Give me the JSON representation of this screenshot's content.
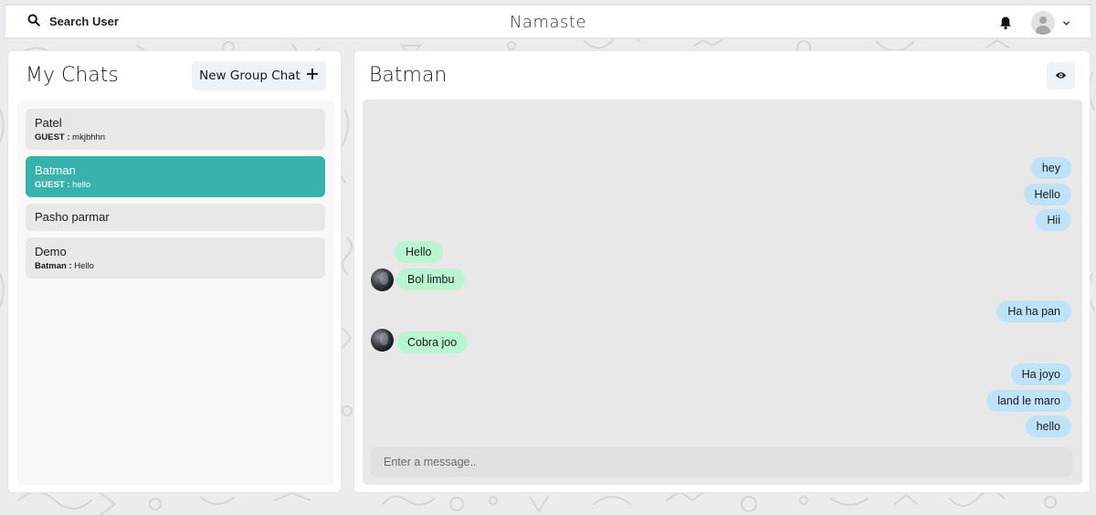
{
  "header": {
    "search_label": "Search User",
    "brand": "Namaste"
  },
  "chats_panel": {
    "title": "My Chats",
    "new_group_label": "New Group Chat",
    "chats": [
      {
        "name": "Patel",
        "sender": "GUEST :",
        "preview": "mkjbhhn",
        "active": false
      },
      {
        "name": "Batman",
        "sender": "GUEST :",
        "preview": "hello",
        "active": true
      },
      {
        "name": "Pasho parmar",
        "sender": "",
        "preview": "",
        "active": false
      },
      {
        "name": "Demo",
        "sender": "Batman :",
        "preview": "Hello",
        "active": false
      }
    ]
  },
  "conversation": {
    "title": "Batman",
    "messages": [
      {
        "text": "hey",
        "direction": "sent"
      },
      {
        "text": "Hello",
        "direction": "sent"
      },
      {
        "text": "Hii",
        "direction": "sent"
      },
      {
        "text": "Hello",
        "direction": "received"
      },
      {
        "text": "Bol limbu",
        "direction": "received"
      },
      {
        "text": "Ha ha pan",
        "direction": "sent"
      },
      {
        "text": "Cobra joo",
        "direction": "received"
      },
      {
        "text": "Ha joyo",
        "direction": "sent"
      },
      {
        "text": "land le maro",
        "direction": "sent"
      },
      {
        "text": "hello",
        "direction": "sent"
      }
    ],
    "input_placeholder": "Enter a message.."
  },
  "colors": {
    "active_chat": "#38b2ac",
    "sent_bubble": "#bee3f8",
    "received_bubble": "#b9f5d0"
  },
  "icons": [
    "search-icon",
    "bell-icon",
    "avatar-icon",
    "chevron-down-icon",
    "plus-icon",
    "eye-icon"
  ]
}
